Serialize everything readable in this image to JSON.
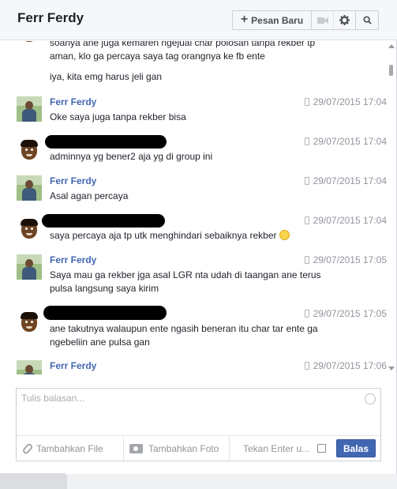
{
  "header": {
    "title": "Ferr Ferdy",
    "new_message_label": "Pesan Baru",
    "icons": [
      "plus-icon",
      "video-icon",
      "gear-icon",
      "search-icon"
    ]
  },
  "thread": {
    "partial_lines": [
      "soanya ane juga kemaren ngejual char polosan tanpa rekber tp",
      "aman, klo ga percaya saya tag orangnya ke fb ente",
      "iya, kita emg harus jeli gan"
    ],
    "messages": [
      {
        "sender": "Ferr Ferdy",
        "redacted": false,
        "time": "29/07/2015 17:04",
        "lines": [
          "Oke saya juga tanpa rekber bisa"
        ]
      },
      {
        "sender": "",
        "redacted": true,
        "time": "29/07/2015 17:04",
        "lines": [
          "adminnya yg bener2 aja yg di group ini"
        ]
      },
      {
        "sender": "Ferr Ferdy",
        "redacted": false,
        "time": "29/07/2015 17:04",
        "lines": [
          "Asal agan percaya"
        ]
      },
      {
        "sender": "",
        "redacted": true,
        "time": "29/07/2015 17:04",
        "lines": [
          "saya percaya aja tp utk menghindari sebaiknya rekber"
        ]
      },
      {
        "sender": "Ferr Ferdy",
        "redacted": false,
        "time": "29/07/2015 17:05",
        "lines": [
          "Saya mau ga rekber jga asal LGR nta udah di taangan ane terus",
          "pulsa langsung saya kirim"
        ]
      },
      {
        "sender": "",
        "redacted": true,
        "time": "29/07/2015 17:05",
        "lines": [
          "ane takutnya walaupun ente ngasih beneran itu char tar ente ga",
          "ngebeliin ane pulsa gan"
        ]
      },
      {
        "sender": "Ferr Ferdy",
        "redacted": false,
        "time": "29/07/2015 17:06",
        "lines": []
      }
    ]
  },
  "composer": {
    "placeholder": "Tulis balasan...",
    "value": "",
    "add_file_label": "Tambahkan File",
    "add_photo_label": "Tambahkan Foto",
    "enter_to_send_label": "Tekan Enter u...",
    "send_label": "Balas"
  },
  "colors": {
    "accent": "#4267b2",
    "sender": "#4267b2",
    "timestamp": "#90949c"
  }
}
